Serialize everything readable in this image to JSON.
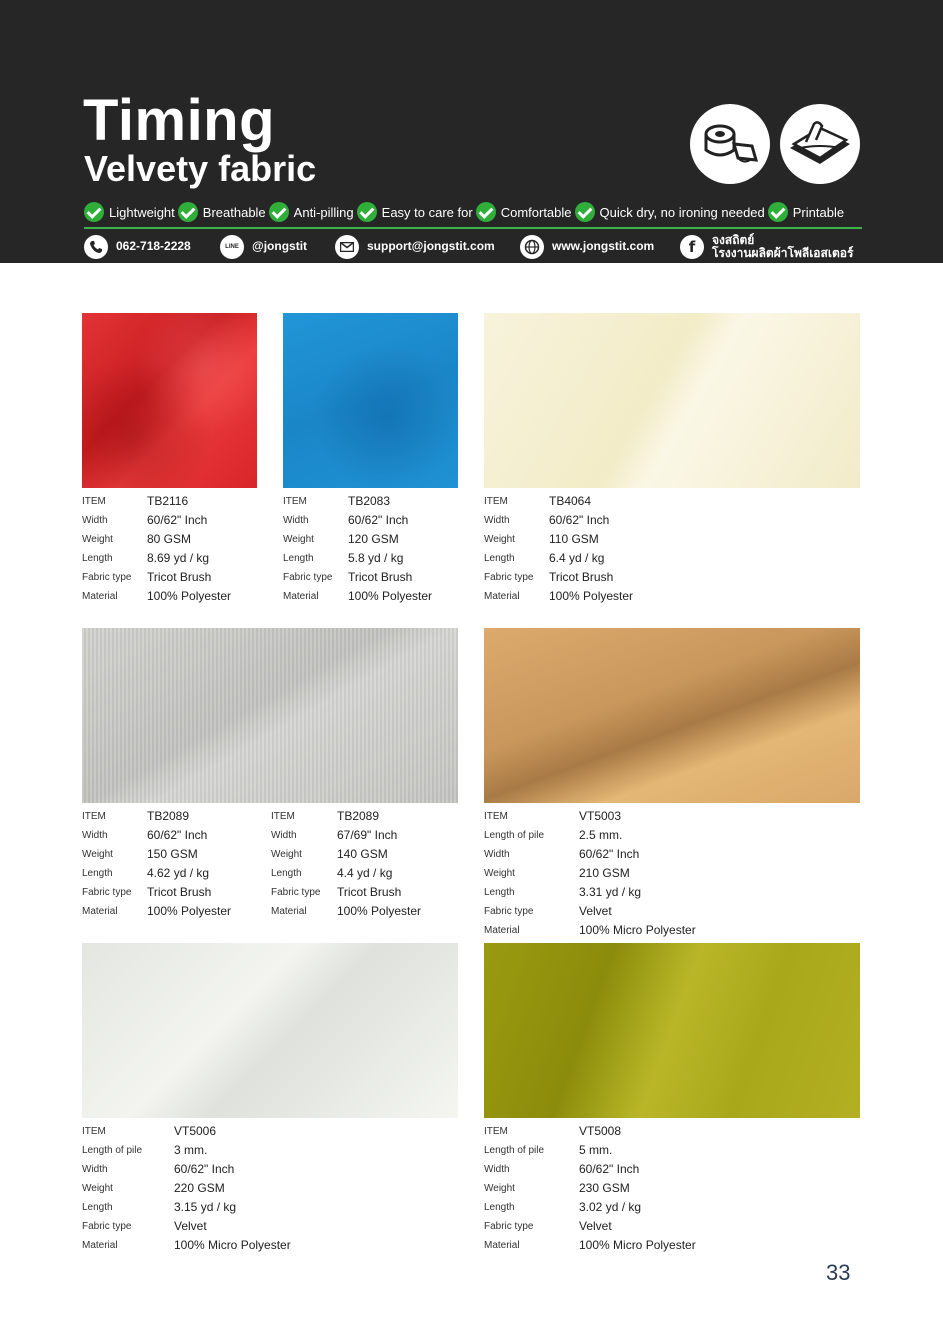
{
  "header": {
    "title": "Timing",
    "subtitle": "Velvety fabric",
    "features": [
      "Lightweight",
      "Breathable",
      "Anti-pilling",
      "Easy to care for",
      "Comfortable",
      "Quick dry, no ironing needed",
      "Printable"
    ],
    "contacts": {
      "phone": "062-718-2228",
      "line": "@jongstit",
      "line_icon": "LINE",
      "email": "support@jongstit.com",
      "web": "www.jongstit.com",
      "facebook_line1": "จงสถิตย์",
      "facebook_line2": "โรงงานผลิตผ้าโพลีเอสเตอร์"
    },
    "colors": {
      "background": "#262626",
      "accent_green": "#3cb44b",
      "check_green": "#2fae3a"
    }
  },
  "products": [
    {
      "color": "#dd2a2c",
      "specs": [
        [
          "ITEM",
          "TB2116"
        ],
        [
          "Width",
          "60/62\" Inch"
        ],
        [
          "Weight",
          "80 GSM"
        ],
        [
          "Length",
          "8.69 yd / kg"
        ],
        [
          "Fabric type",
          "Tricot Brush"
        ],
        [
          "Material",
          "100% Polyester"
        ]
      ]
    },
    {
      "color": "#1b8fd2",
      "specs": [
        [
          "ITEM",
          "TB2083"
        ],
        [
          "Width",
          "60/62\" Inch"
        ],
        [
          "Weight",
          "120 GSM"
        ],
        [
          "Length",
          "5.8 yd / kg"
        ],
        [
          "Fabric type",
          "Tricot Brush"
        ],
        [
          "Material",
          "100% Polyester"
        ]
      ]
    },
    {
      "color": "#f6f0d3",
      "specs": [
        [
          "ITEM",
          "TB4064"
        ],
        [
          "Width",
          "60/62\" Inch"
        ],
        [
          "Weight",
          "110 GSM"
        ],
        [
          "Length",
          "6.4 yd / kg"
        ],
        [
          "Fabric type",
          "Tricot Brush"
        ],
        [
          "Material",
          "100% Polyester"
        ]
      ]
    },
    {
      "color": "#cbcbc8",
      "specs": [
        [
          "ITEM",
          "TB2089"
        ],
        [
          "Width",
          "60/62\" Inch"
        ],
        [
          "Weight",
          "150 GSM"
        ],
        [
          "Length",
          "4.62 yd / kg"
        ],
        [
          "Fabric type",
          "Tricot Brush"
        ],
        [
          "Material",
          "100% Polyester"
        ]
      ]
    },
    {
      "color": "#cbcbc8",
      "specs": [
        [
          "ITEM",
          "TB2089"
        ],
        [
          "Width",
          "67/69\" Inch"
        ],
        [
          "Weight",
          "140 GSM"
        ],
        [
          "Length",
          "4.4 yd / kg"
        ],
        [
          "Fabric type",
          "Tricot Brush"
        ],
        [
          "Material",
          "100% Polyester"
        ]
      ]
    },
    {
      "color": "#d4a468",
      "specs": [
        [
          "ITEM",
          "VT5003"
        ],
        [
          "Length of pile",
          "2.5 mm."
        ],
        [
          "Width",
          "60/62\" Inch"
        ],
        [
          "Weight",
          "210 GSM"
        ],
        [
          "Length",
          "3.31 yd / kg"
        ],
        [
          "Fabric type",
          "Velvet"
        ],
        [
          "Material",
          "100% Micro Polyester"
        ]
      ]
    },
    {
      "color": "#eceeea",
      "specs": [
        [
          "ITEM",
          "VT5006"
        ],
        [
          "Length of pile",
          "3 mm."
        ],
        [
          "Width",
          "60/62\" Inch"
        ],
        [
          "Weight",
          "220 GSM"
        ],
        [
          "Length",
          "3.15 yd / kg"
        ],
        [
          "Fabric type",
          "Velvet"
        ],
        [
          "Material",
          "100% Micro Polyester"
        ]
      ]
    },
    {
      "color": "#a4a414",
      "specs": [
        [
          "ITEM",
          "VT5008"
        ],
        [
          "Length of pile",
          "5 mm."
        ],
        [
          "Width",
          "60/62\" Inch"
        ],
        [
          "Weight",
          "230 GSM"
        ],
        [
          "Length",
          "3.02 yd / kg"
        ],
        [
          "Fabric type",
          "Velvet"
        ],
        [
          "Material",
          "100% Micro Polyester"
        ]
      ]
    }
  ],
  "page_number": "33"
}
